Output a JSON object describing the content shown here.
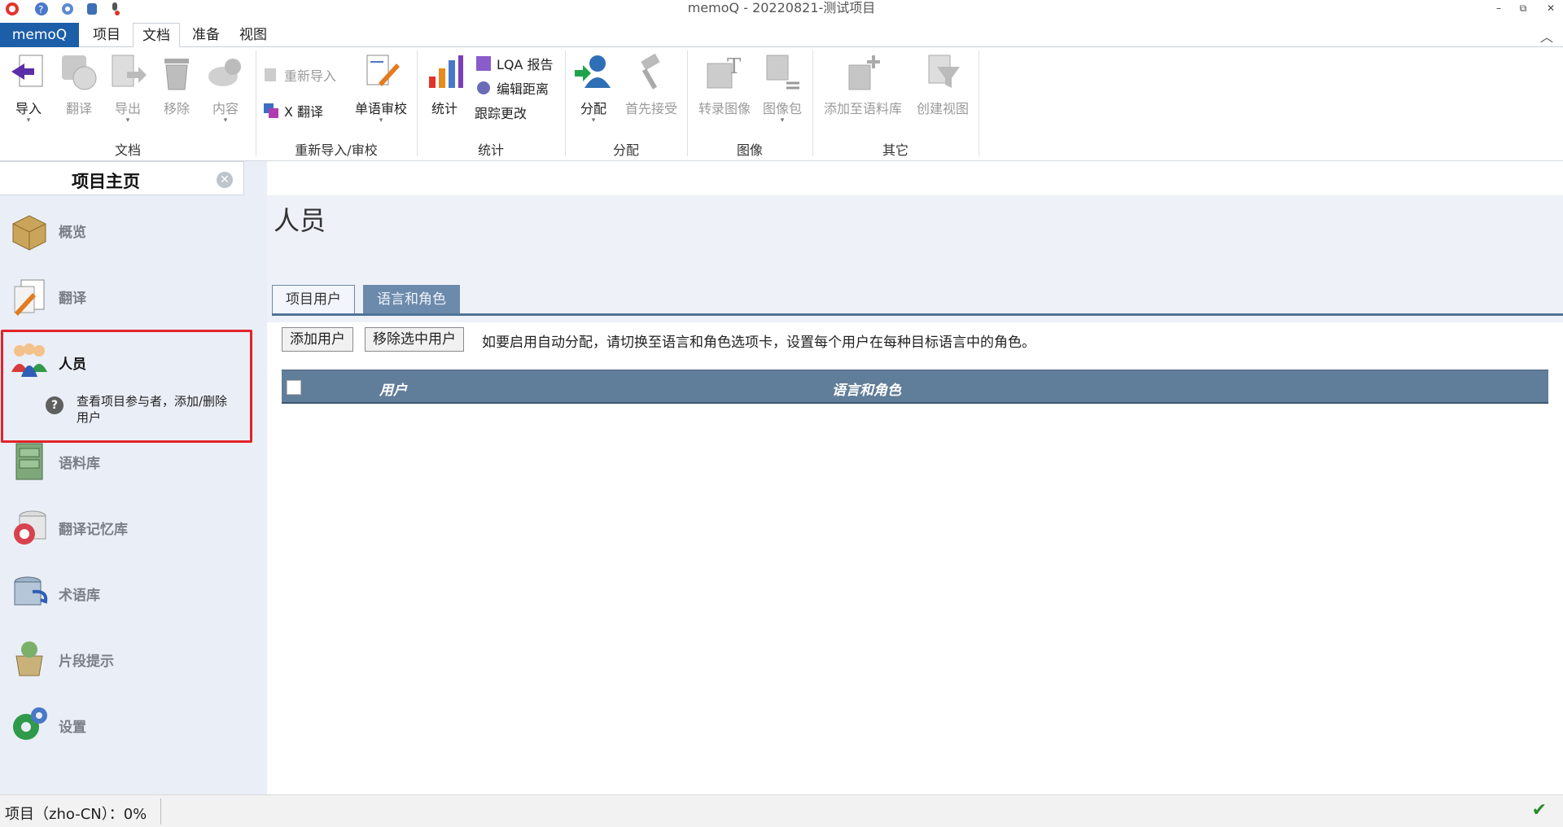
{
  "window": {
    "title": "memoQ - 20220821-测试项目"
  },
  "window_controls": {
    "minimize": "–",
    "restore": "⧉",
    "close": "✕"
  },
  "menu": {
    "app": "memoQ",
    "tabs": [
      "项目",
      "文档",
      "准备",
      "视图"
    ],
    "active_tab": "文档",
    "collapse": "︿"
  },
  "ribbon": {
    "groups": {
      "doc": "文档",
      "reimport": "重新导入/审校",
      "stats": "统计",
      "assign": "分配",
      "image": "图像",
      "other": "其它"
    },
    "buttons": {
      "import": "导入",
      "translate": "翻译",
      "export": "导出",
      "remove": "移除",
      "content": "内容",
      "reimport": "重新导入",
      "xtranslate": "X 翻译",
      "monoreview": "单语审校",
      "stats": "统计",
      "lqa": "LQA 报告",
      "editdist": "编辑距离",
      "track": "跟踪更改",
      "assign": "分配",
      "firstaccept": "首先接受",
      "transcribe": "转录图像",
      "imagepack": "图像包",
      "addtocorpus": "添加至语料库",
      "createview": "创建视图"
    },
    "colors": {
      "brand": "#1d5ea8",
      "disabled": "#9a9a9a"
    }
  },
  "panel": {
    "title": "项目主页",
    "close": "✕",
    "items": [
      {
        "label": "概览",
        "icon": "package-icon"
      },
      {
        "label": "翻译",
        "icon": "translate-doc-icon"
      },
      {
        "label": "人员",
        "icon": "people-icon",
        "active": true,
        "description": "查看项目参与者，添加/删除用户",
        "help": "?"
      },
      {
        "label": "语料库",
        "icon": "cabinet-icon"
      },
      {
        "label": "翻译记忆库",
        "icon": "tm-icon"
      },
      {
        "label": "术语库",
        "icon": "termbase-icon"
      },
      {
        "label": "片段提示",
        "icon": "muse-icon"
      },
      {
        "label": "设置",
        "icon": "settings-icon"
      }
    ]
  },
  "main": {
    "title": "人员",
    "tabs": [
      "项目用户",
      "语言和角色"
    ],
    "active_tab": "项目用户",
    "add_user": "添加用户",
    "remove_user": "移除选中用户",
    "hint": "如要启用自动分配，请切换至语言和角色选项卡，设置每个用户在每种目标语言中的角色。",
    "columns": [
      "用户",
      "语言和角色"
    ],
    "rows": []
  },
  "status": {
    "text": "项目（zho-CN）：0%",
    "ok": "✔"
  }
}
